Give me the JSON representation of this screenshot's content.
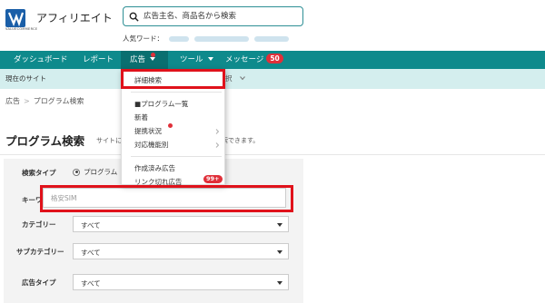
{
  "header": {
    "logo_icon": "valuecommerce-logo-icon",
    "logo_subtext": "VALUECOMMERCE",
    "title": "アフィリエイト",
    "search_placeholder": "広告主名、商品名から検索",
    "popular_label": "人気ワード："
  },
  "nav": {
    "items": [
      {
        "label": "ダッシュボード"
      },
      {
        "label": "レポート"
      },
      {
        "label": "広告"
      },
      {
        "label": "ツール"
      },
      {
        "label": "メッセージ",
        "badge": "50"
      }
    ]
  },
  "sitebar": {
    "label": "現在のサイト",
    "fragment": "択"
  },
  "breadcrumb": {
    "root": "広告",
    "separator": ">",
    "current": "プログラム検索"
  },
  "page": {
    "title": "プログラム検索",
    "desc_left": "サイトに",
    "desc_right": "索できます。"
  },
  "dropdown": {
    "items": [
      {
        "label": "詳細検索"
      },
      {
        "label": "■プログラム一覧"
      },
      {
        "label": "新着"
      },
      {
        "label": "提携状況"
      },
      {
        "label": "対応機能別"
      },
      {
        "label": "作成済み広告"
      },
      {
        "label": "リンク切れ広告",
        "badge": "99+"
      }
    ]
  },
  "form": {
    "search_type_label": "検索タイプ",
    "search_type_value": "プログラム",
    "keyword_label": "キーワード",
    "keyword_placeholder": "格安SIM",
    "category_label": "カテゴリー",
    "category_value": "すべて",
    "subcategory_label": "サブカテゴリー",
    "subcategory_value": "すべて",
    "adtype_label": "広告タイプ",
    "adtype_value": "すべて"
  },
  "colors": {
    "nav_bg": "#0e8a8c",
    "nav_active": "#0a6f70",
    "accent_red": "#e0303a",
    "highlight": "#e0121b",
    "sitebar_bg": "#d4eeee"
  }
}
